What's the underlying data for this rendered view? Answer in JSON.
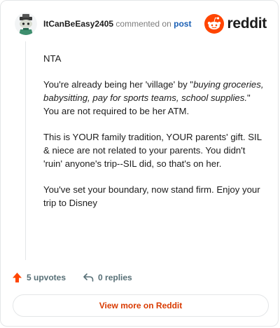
{
  "header": {
    "username": "ItCanBeEasy2405",
    "action_text": "commented on",
    "post_link": "post",
    "brand": "reddit",
    "avatar_icon": "snoo-avatar-icon",
    "logo_icon": "reddit-logo-icon"
  },
  "comment": {
    "p1": "NTA",
    "p2_a": "You're already being her 'village' by \"",
    "p2_em": "buying groceries, babysitting, pay for sports teams, school supplies.",
    "p2_b": "\" You are not required to be her ATM.",
    "p3": "This is YOUR family tradition, YOUR parents' gift. SIL & niece are not related to your parents. You didn't 'ruin' anyone's trip--SIL did, so that's on her.",
    "p4": "You've set your boundary, now stand firm. Enjoy your trip to Disney"
  },
  "footer": {
    "upvotes": "5 upvotes",
    "replies": "0 replies",
    "upvote_icon": "upvote-arrow-icon",
    "reply_icon": "reply-arrow-icon"
  },
  "view_more": "View more on Reddit",
  "colors": {
    "accent": "#ff4500",
    "link": "#d93a00",
    "border": "#e4e6e8"
  }
}
